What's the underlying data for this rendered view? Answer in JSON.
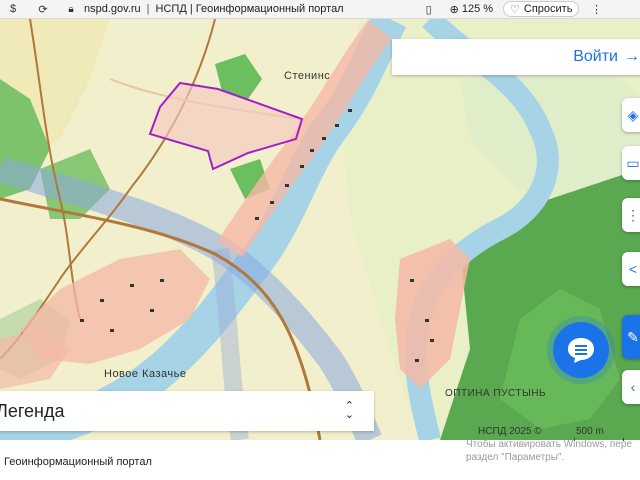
{
  "browser": {
    "url": "nspd.gov.ru",
    "separator": "|",
    "tab_title": "НСПД | Геоинформационный портал",
    "zoom": "125 %",
    "ask_label": "Спросить",
    "icons": [
      "dollar-icon",
      "refresh-icon",
      "lock-icon",
      "bookmark-icon",
      "zoom-icon",
      "ask-icon",
      "more-icon"
    ]
  },
  "map": {
    "places": {
      "stenino": "Стенинс",
      "novoe_kazachye": "Новое Казачье",
      "optina_pustyn": "ОПТИНА ПУСТЫНЬ"
    },
    "login_label": "Войти",
    "legend_title": "Легенда",
    "copyright": "НСПД 2025 ©",
    "scale_label": "500 m",
    "colors": {
      "accent": "#1a73e8",
      "parcel_outline": "#a020c8",
      "forest": "#5cb85c",
      "river": "#a6d4e6"
    }
  },
  "system": {
    "activate_line1": "Чтобы активировать Windows, пере",
    "activate_line2": "раздел \"Параметры\"."
  },
  "status_bar": {
    "label": "Геоинформационный портал"
  }
}
